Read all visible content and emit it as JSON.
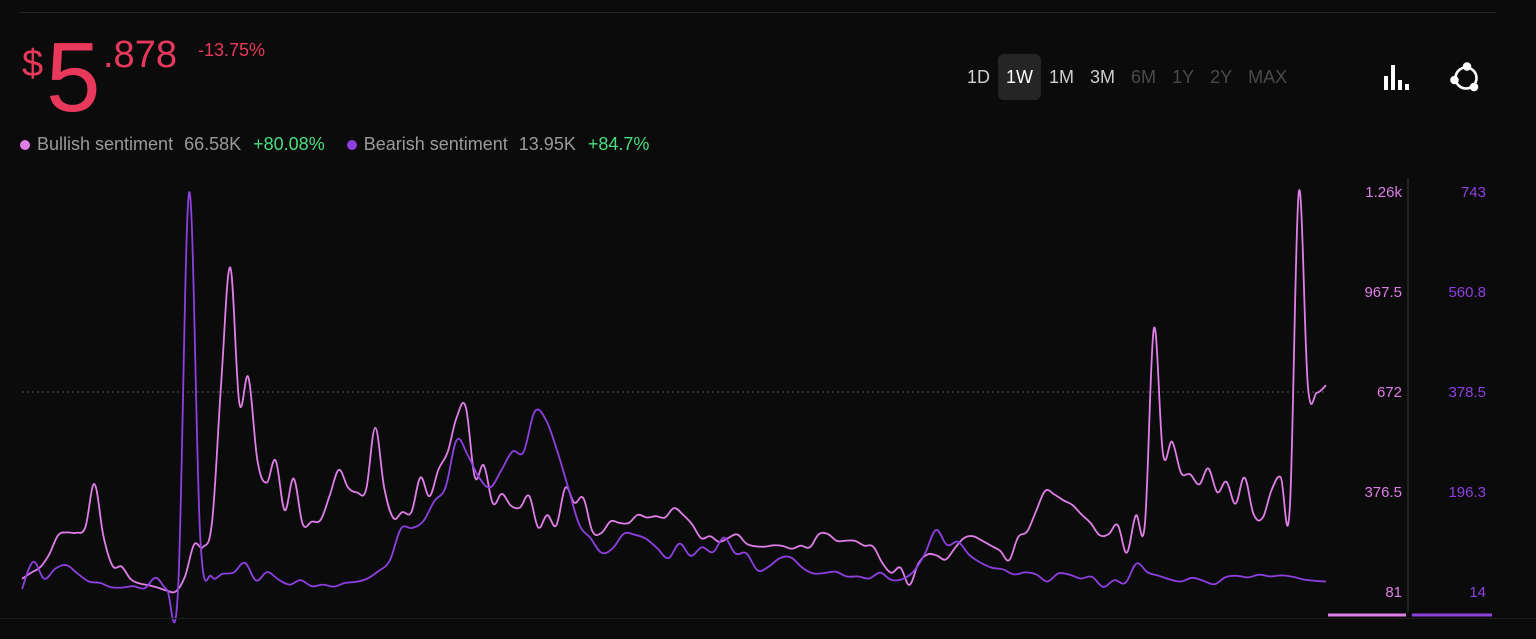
{
  "price": {
    "currency": "$",
    "whole": "5",
    "fraction": ".878",
    "change": "-13.75%",
    "color": "#e8395c"
  },
  "legend": [
    {
      "label": "Bullish sentiment",
      "value": "66.58K",
      "change": "+80.08%",
      "color": "#e07ee8"
    },
    {
      "label": "Bearish sentiment",
      "value": "13.95K",
      "change": "+84.7%",
      "color": "#8e3fe0"
    }
  ],
  "positive_color": "#4ade80",
  "ranges": [
    {
      "label": "1D",
      "state": "normal"
    },
    {
      "label": "1W",
      "state": "active"
    },
    {
      "label": "1M",
      "state": "normal"
    },
    {
      "label": "3M",
      "state": "normal"
    },
    {
      "label": "6M",
      "state": "disabled"
    },
    {
      "label": "1Y",
      "state": "disabled"
    },
    {
      "label": "2Y",
      "state": "disabled"
    },
    {
      "label": "MAX",
      "state": "disabled"
    }
  ],
  "icons": [
    "bar-chart-icon",
    "share-network-icon"
  ],
  "chart_data": {
    "type": "line",
    "grid": false,
    "reference_line": {
      "axis": "left",
      "value": 672
    },
    "left_axis": {
      "ticks": [
        "1.26k",
        "967.5",
        "672",
        "376.5",
        "81"
      ],
      "ylim": [
        81,
        1263
      ],
      "color": "#e07ee8"
    },
    "right_axis": {
      "ticks": [
        "743",
        "560.8",
        "378.5",
        "196.3",
        "14"
      ],
      "ylim": [
        14,
        743
      ],
      "color": "#8e3fe0"
    },
    "series": [
      {
        "name": "Bullish sentiment",
        "axis": "left",
        "color": "#e07ee8",
        "values": [
          120,
          138,
          154,
          192,
          249,
          257,
          256,
          273,
          400,
          245,
          158,
          156,
          119,
          106,
          101,
          94,
          85,
          83,
          127,
          221,
          214,
          292,
          700,
          1040,
          640,
          715,
          470,
          404,
          470,
          323,
          416,
          282,
          289,
          295,
          368,
          442,
          390,
          375,
          384,
          566,
          389,
          300,
          317,
          317,
          419,
          364,
          444,
          494,
          597,
          628,
          421,
          455,
          343,
          371,
          336,
          331,
          365,
          272,
          308,
          278,
          389,
          345,
          358,
          260,
          256,
          290,
          285,
          285,
          309,
          301,
          305,
          301,
          329,
          309,
          281,
          240,
          246,
          229,
          241,
          251,
          224,
          216,
          215,
          219,
          217,
          209,
          218,
          213,
          252,
          252,
          232,
          233,
          232,
          218,
          215,
          167,
          138,
          153,
          102,
          166,
          192,
          189,
          177,
          210,
          240,
          246,
          233,
          218,
          203,
          175,
          243,
          260,
          321,
          380,
          369,
          352,
          338,
          310,
          285,
          249,
          252,
          279,
          197,
          307,
          282,
          860,
          489,
          525,
          433,
          429,
          399,
          446,
          376,
          407,
          342,
          419,
          311,
          300,
          383,
          420,
          328,
          1263,
          690,
          670,
          692
        ]
      },
      {
        "name": "Bearish sentiment",
        "axis": "left",
        "color": "#8e3fe0",
        "values": [
          90,
          170,
          120,
          150,
          160,
          135,
          112,
          108,
          95,
          94,
          98,
          92,
          123,
          88,
          85,
          1262,
          240,
          127,
          135,
          139,
          167,
          115,
          140,
          118,
          103,
          116,
          98,
          103,
          97,
          108,
          111,
          121,
          143,
          174,
          268,
          270,
          290,
          350,
          390,
          530,
          485,
          420,
          390,
          440,
          496,
          495,
          614,
          590,
          500,
          390,
          280,
          241,
          197,
          210,
          253,
          250,
          238,
          210,
          181,
          224,
          188,
          213,
          199,
          242,
          195,
          195,
          145,
          156,
          181,
          183,
          153,
          136,
          137,
          141,
          127,
          127,
          121,
          138,
          117,
          119,
          142,
          193,
          264,
          220,
          229,
          190,
          168,
          153,
          148,
          133,
          139,
          133,
          112,
          136,
          132,
          121,
          126,
          96,
          116,
          108,
          165,
          139,
          129,
          118,
          112,
          123,
          114,
          104,
          125,
          129,
          124,
          132,
          127,
          130,
          126,
          118,
          114,
          112
        ]
      }
    ]
  }
}
